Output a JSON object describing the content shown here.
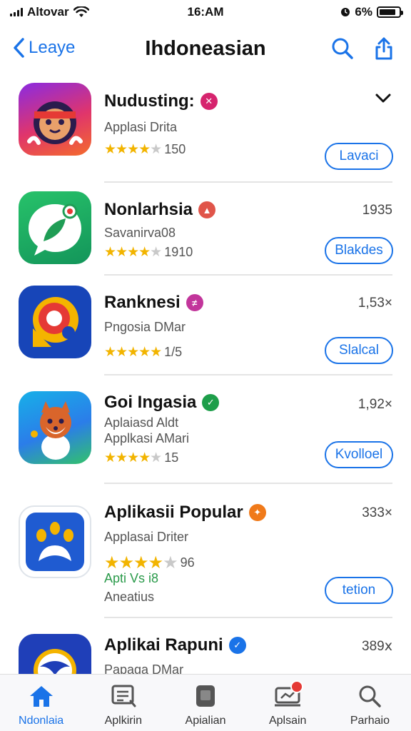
{
  "status_bar": {
    "carrier": "Altovar",
    "time": "16:AM",
    "battery_text": "6%",
    "battery_level": 0.85
  },
  "nav": {
    "back_label": "Leaye",
    "title": "Ihdoneasian",
    "search_icon": "search-icon",
    "share_icon": "share-icon"
  },
  "apps": [
    {
      "name": "Nudusting:",
      "subtitle": "Applasi Drita",
      "rating_text": "150",
      "stars_full": 4,
      "stars_dim": 1,
      "size": "",
      "button_label": "Lavaci",
      "badge_color": "#d6246e",
      "badge_glyph": "✕"
    },
    {
      "name": "Nonlarhsia",
      "subtitle": "Savanirva08",
      "rating_text": "1910",
      "stars_full": 4,
      "stars_dim": 1,
      "size": "1935",
      "button_label": "Blakdes",
      "badge_color": "#e0554a",
      "badge_glyph": "▲"
    },
    {
      "name": "Ranknesi",
      "subtitle": "Pngosia DMar",
      "rating_text": "1/5",
      "stars_full": 5,
      "stars_dim": 0,
      "size": "1,53×",
      "button_label": "Slalcal",
      "badge_color": "#c2359b",
      "badge_glyph": "≠"
    },
    {
      "name": "Goi Ingasia",
      "subtitle": "Aplaiasd Aldt",
      "subtitle2": "Applkasi AMari",
      "rating_text": "15",
      "stars_full": 4,
      "stars_dim": 1,
      "size": "1,92×",
      "button_label": "Kvolloel",
      "badge_color": "#1e9e4a",
      "badge_glyph": "✓"
    },
    {
      "name": "Aplikasii Popular",
      "subtitle": "Applasai Driter",
      "rating_text": "96",
      "stars_full": 4,
      "stars_dim": 1,
      "extra1": "Apti Vs i8",
      "extra2": "Aneatius",
      "size": "333×",
      "button_label": "tetion",
      "badge_color": "#f07a1a",
      "badge_glyph": "✦"
    },
    {
      "name": "Aplikai Rapuni",
      "subtitle": "Papaga DMar",
      "size": "389ⅹ",
      "badge_color": "#1a73e8",
      "badge_glyph": "✓"
    }
  ],
  "tabs": [
    {
      "label": "Ndonlaia",
      "icon": "home-icon",
      "active": true
    },
    {
      "label": "Aplkirin",
      "icon": "list-icon",
      "active": false
    },
    {
      "label": "Apialian",
      "icon": "apps-icon",
      "active": false
    },
    {
      "label": "Aplsain",
      "icon": "updates-icon",
      "active": false
    },
    {
      "label": "Parhaio",
      "icon": "search-icon",
      "active": false
    }
  ]
}
